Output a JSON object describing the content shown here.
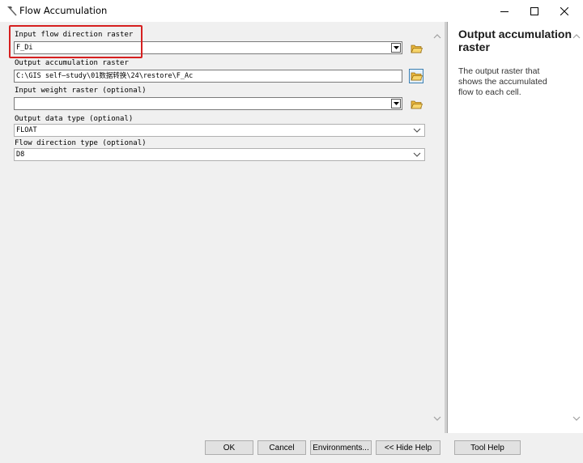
{
  "window": {
    "title": "Flow Accumulation",
    "icon": "hammer-icon",
    "controls": [
      "minimize-icon",
      "maximize-icon",
      "close-icon"
    ]
  },
  "form": {
    "input_flow_direction": {
      "label": "Input flow direction raster",
      "value": "F_Di"
    },
    "output_accumulation": {
      "label": "Output accumulation raster",
      "value": "C:\\GIS  self—study\\01数据转换\\24\\restore\\F_Ac"
    },
    "input_weight": {
      "label": "Input weight raster (optional)",
      "value": ""
    },
    "output_data_type": {
      "label": "Output data type (optional)",
      "value": "FLOAT"
    },
    "flow_direction_type": {
      "label": "Flow direction type (optional)",
      "value": "D8"
    }
  },
  "help": {
    "title": "Output accumulation raster",
    "text": "The output raster that shows the accumulated flow to each cell."
  },
  "buttons": {
    "ok": "OK",
    "cancel": "Cancel",
    "environments": "Environments...",
    "hide_help": "<< Hide Help",
    "tool_help": "Tool Help"
  },
  "colors": {
    "highlight": "#d62020",
    "active_button_border": "#3c7fb1"
  }
}
